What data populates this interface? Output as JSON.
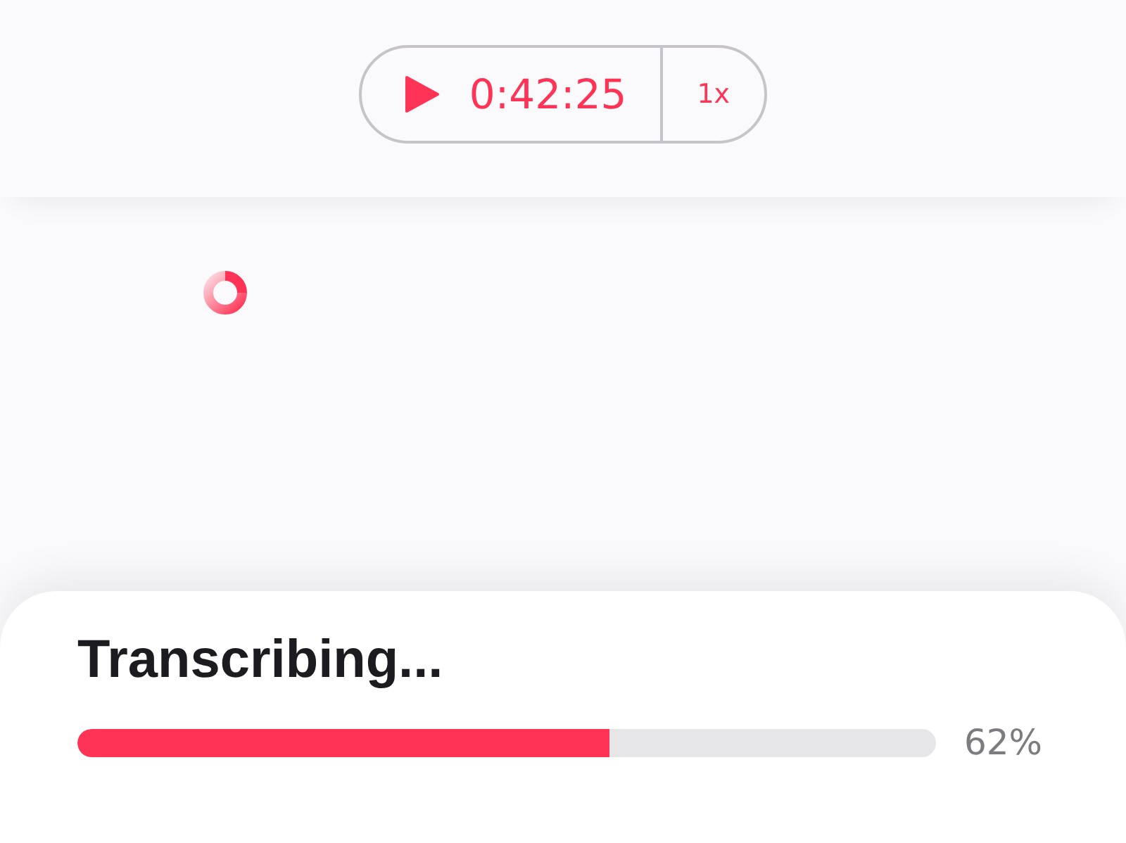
{
  "player": {
    "time": "0:42:25",
    "speed": "1x"
  },
  "status": {
    "title": "Transcribing...",
    "level": 0.62,
    "reading": "62%"
  }
}
